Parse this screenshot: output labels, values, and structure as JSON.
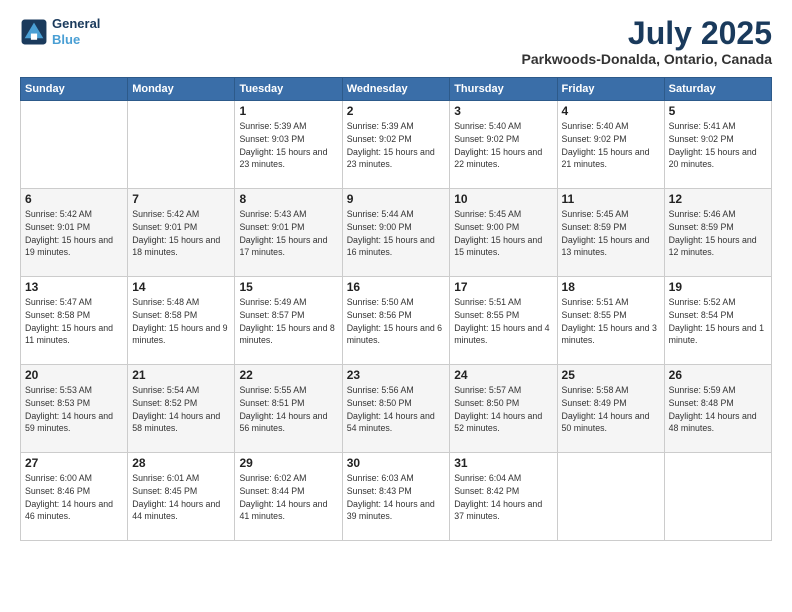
{
  "header": {
    "logo_line1": "General",
    "logo_line2": "Blue",
    "title": "July 2025",
    "subtitle": "Parkwoods-Donalda, Ontario, Canada"
  },
  "days_of_week": [
    "Sunday",
    "Monday",
    "Tuesday",
    "Wednesday",
    "Thursday",
    "Friday",
    "Saturday"
  ],
  "weeks": [
    [
      {
        "day": "",
        "info": ""
      },
      {
        "day": "",
        "info": ""
      },
      {
        "day": "1",
        "info": "Sunrise: 5:39 AM\nSunset: 9:03 PM\nDaylight: 15 hours\nand 23 minutes."
      },
      {
        "day": "2",
        "info": "Sunrise: 5:39 AM\nSunset: 9:02 PM\nDaylight: 15 hours\nand 23 minutes."
      },
      {
        "day": "3",
        "info": "Sunrise: 5:40 AM\nSunset: 9:02 PM\nDaylight: 15 hours\nand 22 minutes."
      },
      {
        "day": "4",
        "info": "Sunrise: 5:40 AM\nSunset: 9:02 PM\nDaylight: 15 hours\nand 21 minutes."
      },
      {
        "day": "5",
        "info": "Sunrise: 5:41 AM\nSunset: 9:02 PM\nDaylight: 15 hours\nand 20 minutes."
      }
    ],
    [
      {
        "day": "6",
        "info": "Sunrise: 5:42 AM\nSunset: 9:01 PM\nDaylight: 15 hours\nand 19 minutes."
      },
      {
        "day": "7",
        "info": "Sunrise: 5:42 AM\nSunset: 9:01 PM\nDaylight: 15 hours\nand 18 minutes."
      },
      {
        "day": "8",
        "info": "Sunrise: 5:43 AM\nSunset: 9:01 PM\nDaylight: 15 hours\nand 17 minutes."
      },
      {
        "day": "9",
        "info": "Sunrise: 5:44 AM\nSunset: 9:00 PM\nDaylight: 15 hours\nand 16 minutes."
      },
      {
        "day": "10",
        "info": "Sunrise: 5:45 AM\nSunset: 9:00 PM\nDaylight: 15 hours\nand 15 minutes."
      },
      {
        "day": "11",
        "info": "Sunrise: 5:45 AM\nSunset: 8:59 PM\nDaylight: 15 hours\nand 13 minutes."
      },
      {
        "day": "12",
        "info": "Sunrise: 5:46 AM\nSunset: 8:59 PM\nDaylight: 15 hours\nand 12 minutes."
      }
    ],
    [
      {
        "day": "13",
        "info": "Sunrise: 5:47 AM\nSunset: 8:58 PM\nDaylight: 15 hours\nand 11 minutes."
      },
      {
        "day": "14",
        "info": "Sunrise: 5:48 AM\nSunset: 8:58 PM\nDaylight: 15 hours\nand 9 minutes."
      },
      {
        "day": "15",
        "info": "Sunrise: 5:49 AM\nSunset: 8:57 PM\nDaylight: 15 hours\nand 8 minutes."
      },
      {
        "day": "16",
        "info": "Sunrise: 5:50 AM\nSunset: 8:56 PM\nDaylight: 15 hours\nand 6 minutes."
      },
      {
        "day": "17",
        "info": "Sunrise: 5:51 AM\nSunset: 8:55 PM\nDaylight: 15 hours\nand 4 minutes."
      },
      {
        "day": "18",
        "info": "Sunrise: 5:51 AM\nSunset: 8:55 PM\nDaylight: 15 hours\nand 3 minutes."
      },
      {
        "day": "19",
        "info": "Sunrise: 5:52 AM\nSunset: 8:54 PM\nDaylight: 15 hours\nand 1 minute."
      }
    ],
    [
      {
        "day": "20",
        "info": "Sunrise: 5:53 AM\nSunset: 8:53 PM\nDaylight: 14 hours\nand 59 minutes."
      },
      {
        "day": "21",
        "info": "Sunrise: 5:54 AM\nSunset: 8:52 PM\nDaylight: 14 hours\nand 58 minutes."
      },
      {
        "day": "22",
        "info": "Sunrise: 5:55 AM\nSunset: 8:51 PM\nDaylight: 14 hours\nand 56 minutes."
      },
      {
        "day": "23",
        "info": "Sunrise: 5:56 AM\nSunset: 8:50 PM\nDaylight: 14 hours\nand 54 minutes."
      },
      {
        "day": "24",
        "info": "Sunrise: 5:57 AM\nSunset: 8:50 PM\nDaylight: 14 hours\nand 52 minutes."
      },
      {
        "day": "25",
        "info": "Sunrise: 5:58 AM\nSunset: 8:49 PM\nDaylight: 14 hours\nand 50 minutes."
      },
      {
        "day": "26",
        "info": "Sunrise: 5:59 AM\nSunset: 8:48 PM\nDaylight: 14 hours\nand 48 minutes."
      }
    ],
    [
      {
        "day": "27",
        "info": "Sunrise: 6:00 AM\nSunset: 8:46 PM\nDaylight: 14 hours\nand 46 minutes."
      },
      {
        "day": "28",
        "info": "Sunrise: 6:01 AM\nSunset: 8:45 PM\nDaylight: 14 hours\nand 44 minutes."
      },
      {
        "day": "29",
        "info": "Sunrise: 6:02 AM\nSunset: 8:44 PM\nDaylight: 14 hours\nand 41 minutes."
      },
      {
        "day": "30",
        "info": "Sunrise: 6:03 AM\nSunset: 8:43 PM\nDaylight: 14 hours\nand 39 minutes."
      },
      {
        "day": "31",
        "info": "Sunrise: 6:04 AM\nSunset: 8:42 PM\nDaylight: 14 hours\nand 37 minutes."
      },
      {
        "day": "",
        "info": ""
      },
      {
        "day": "",
        "info": ""
      }
    ]
  ]
}
